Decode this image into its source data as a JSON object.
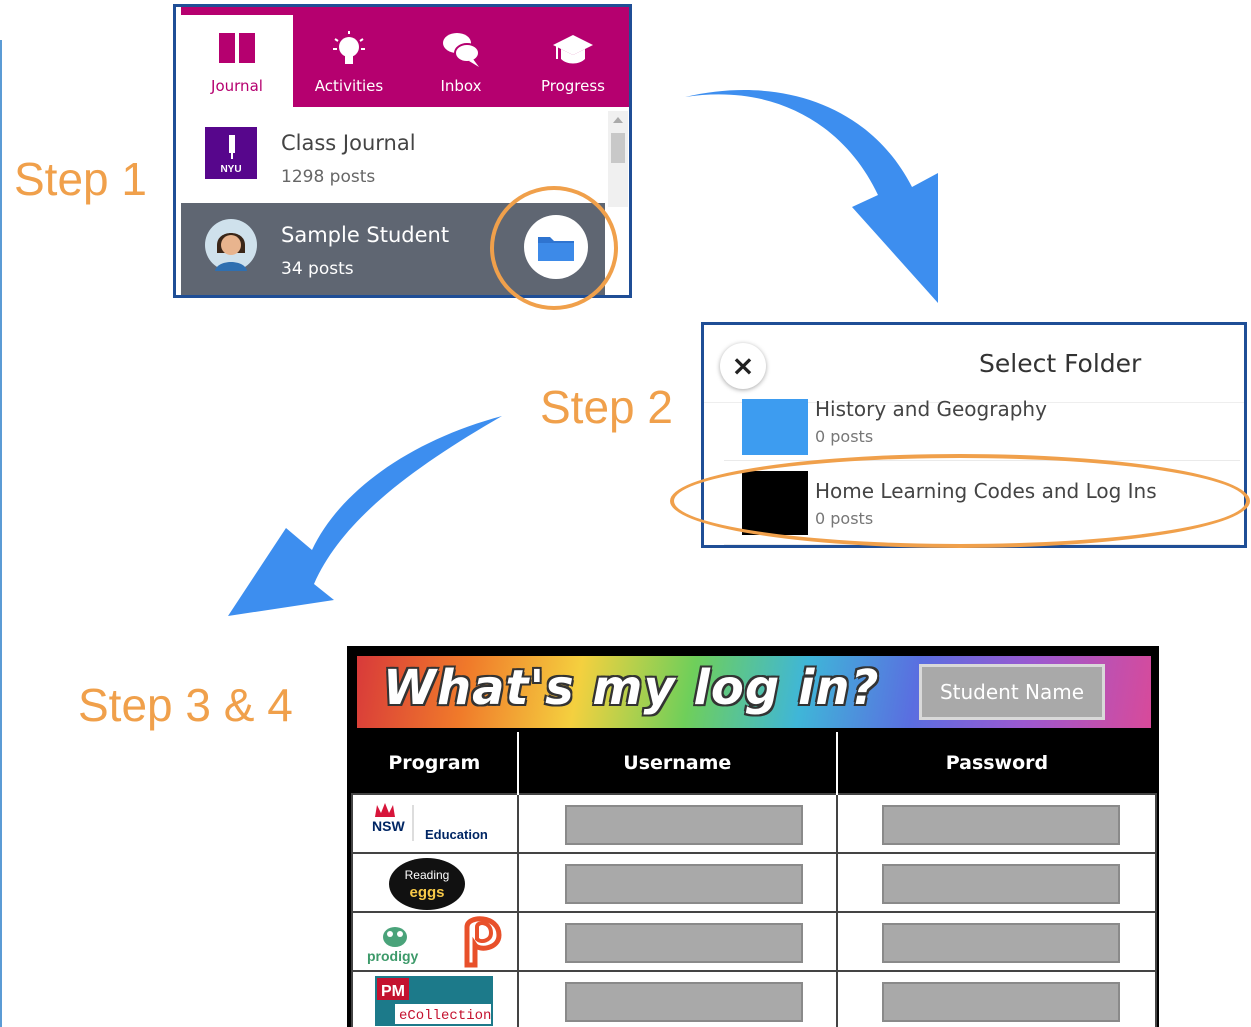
{
  "steps": {
    "step1": "Step 1",
    "step2": "Step 2",
    "step3_4": "Step 3 & 4"
  },
  "app_panel": {
    "tabs": [
      {
        "label": "Journal",
        "icon": "book-icon",
        "active": true
      },
      {
        "label": "Activities",
        "icon": "lightbulb-icon",
        "active": false
      },
      {
        "label": "Inbox",
        "icon": "chat-bubbles-icon",
        "active": false
      },
      {
        "label": "Progress",
        "icon": "graduation-cap-icon",
        "active": false
      }
    ],
    "class_journal": {
      "title": "Class Journal",
      "posts": "1298 posts",
      "avatar_text": "NYU"
    },
    "student": {
      "title": "Sample Student",
      "posts": "34 posts"
    },
    "colors": {
      "brand": "#b5006f",
      "selected_row": "#5f6672",
      "folder": "#2f74d0",
      "highlight": "#f0a04b"
    }
  },
  "folder_panel": {
    "title": "Select Folder",
    "close_label": "×",
    "folders": [
      {
        "title": "History and Geography",
        "posts": "0 posts",
        "color": "#3d9cf0"
      },
      {
        "title": "Home Learning Codes and Log Ins",
        "posts": "0 posts",
        "color": "#000000"
      }
    ]
  },
  "login_sheet": {
    "banner_title": "What's my log in?",
    "student_name": "Student Name",
    "columns": [
      "Program",
      "Username",
      "Password"
    ],
    "programs": [
      {
        "name": "NSW Education",
        "logo_top": "NSW",
        "logo_side": "Education"
      },
      {
        "name": "Reading Eggs",
        "logo_top": "Reading",
        "logo_bottom": "eggs"
      },
      {
        "name": "Prodigy / Pearson",
        "logo_left": "prodigy"
      },
      {
        "name": "PM eCollection",
        "logo_top": "PM",
        "logo_bottom": "eCollection"
      }
    ]
  }
}
